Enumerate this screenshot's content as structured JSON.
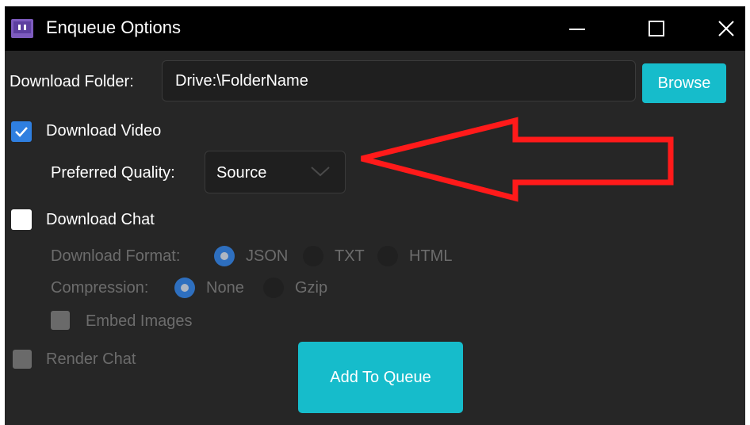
{
  "window": {
    "title": "Enqueue Options",
    "app_icon": "twitch-logo-icon",
    "controls": [
      "minimize-icon",
      "maximize-icon",
      "close-icon"
    ]
  },
  "download_folder": {
    "label": "Download Folder:",
    "value": "Drive:\\FolderName",
    "browse_label": "Browse"
  },
  "download_video": {
    "label": "Download Video",
    "checked": true,
    "preferred_quality_label": "Preferred Quality:",
    "preferred_quality_value": "Source"
  },
  "download_chat": {
    "label": "Download Chat",
    "checked": false,
    "format_label": "Download Format:",
    "formats": [
      {
        "label": "JSON",
        "selected": true
      },
      {
        "label": "TXT",
        "selected": false
      },
      {
        "label": "HTML",
        "selected": false
      }
    ],
    "compression_label": "Compression:",
    "compressions": [
      {
        "label": "None",
        "selected": true
      },
      {
        "label": "Gzip",
        "selected": false
      }
    ],
    "embed_images_label": "Embed Images"
  },
  "render_chat": {
    "label": "Render Chat"
  },
  "add_to_queue_label": "Add To Queue",
  "colors": {
    "accent": "#16bccb",
    "checkbox_blue": "#2f7fe0",
    "annotation_red": "#ff1a1a",
    "background": "#262626",
    "titlebar": "#000000"
  }
}
